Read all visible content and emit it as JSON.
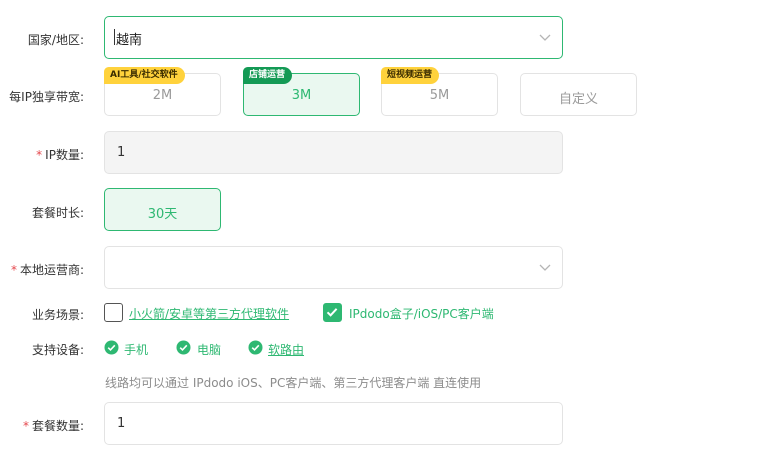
{
  "country": {
    "label": "国家/地区:",
    "value": "越南"
  },
  "bandwidth": {
    "label": "每IP独享带宽:",
    "options": [
      {
        "value": "2M",
        "tag": "AI工具/社交软件",
        "tag_color": "#ffd23c",
        "selected": false
      },
      {
        "value": "3M",
        "tag": "店铺运营",
        "tag_color": "#149a55",
        "selected": true
      },
      {
        "value": "5M",
        "tag": "短视频运营",
        "tag_color": "#ffd23c",
        "selected": false
      },
      {
        "value": "自定义",
        "tag": "",
        "selected": false
      }
    ]
  },
  "ip_count": {
    "required_mark": "*",
    "label": "IP数量:",
    "value": "1"
  },
  "duration": {
    "label": "套餐时长:",
    "value": "30天"
  },
  "carrier": {
    "required_mark": "*",
    "label": "本地运营商:",
    "value": ""
  },
  "scenario": {
    "label": "业务场景:",
    "options": [
      {
        "text": "小火箭/安卓等第三方代理软件",
        "checked": false
      },
      {
        "text": "IPdodo盒子/iOS/PC客户端",
        "checked": true
      }
    ]
  },
  "devices": {
    "label": "支持设备:",
    "items": [
      {
        "text": "手机",
        "icon": "check-circle-icon"
      },
      {
        "text": "电脑",
        "icon": "check-circle-icon"
      },
      {
        "text": "软路由",
        "icon": "check-circle-icon"
      }
    ],
    "hint": "线路均可以通过 IPdodo iOS、PC客户端、第三方代理客户端 直连使用"
  },
  "package_qty": {
    "required_mark": "*",
    "label": "套餐数量:",
    "value": "1"
  },
  "colors": {
    "accent": "#2eb872",
    "accent_bg": "#eaf8f0",
    "required": "#e5484d"
  }
}
